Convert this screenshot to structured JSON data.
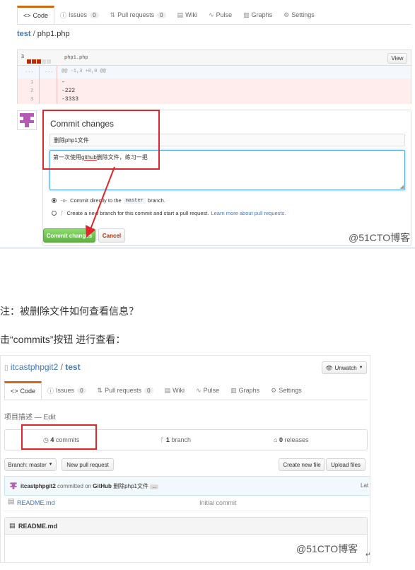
{
  "top": {
    "tabs": [
      {
        "icon": "<>",
        "label": "Code",
        "count": null
      },
      {
        "icon": "ⓘ",
        "label": "Issues",
        "count": "0"
      },
      {
        "icon": "⇅",
        "label": "Pull requests",
        "count": "0"
      },
      {
        "icon": "▤",
        "label": "Wiki",
        "count": null
      },
      {
        "icon": "∿",
        "label": "Pulse",
        "count": null
      },
      {
        "icon": "▥",
        "label": "Graphs",
        "count": null
      },
      {
        "icon": "⚙",
        "label": "Settings",
        "count": null
      }
    ],
    "breadcrumb_repo": "test",
    "breadcrumb_sep": " / ",
    "breadcrumb_file": "php1.php",
    "diff_count": "3",
    "diff_filename": "php1.php",
    "view_button": "View",
    "hunk_dots1": "...",
    "hunk_dots2": "...",
    "hunk_header": "@@ -1,3 +0,0 @@",
    "diff_lines": [
      {
        "num": "1",
        "text": "-"
      },
      {
        "num": "2",
        "text": "-222"
      },
      {
        "num": "3",
        "text": "-3333"
      }
    ],
    "commit_title": "Commit changes",
    "commit_summary": "删除php1文件",
    "commit_desc_pre": "第一次使用",
    "commit_desc_link": "github",
    "commit_desc_post": "删除文件，练习一把",
    "radio1_pre": "Commit directly to the",
    "radio1_branch": "master",
    "radio1_post": "branch.",
    "radio2_pre": "Create a new branch for this commit and start a pull request.",
    "radio2_link": "Learn more about pull requests.",
    "commit_button": "Commit changes",
    "cancel_button": "Cancel",
    "watermark": "@51CTO博客"
  },
  "text1": "注：被删除文件如何查看信息？",
  "text2": "击“commits”按钮 进行查看：",
  "bottom": {
    "owner": "itcastphpgit2",
    "sep": " / ",
    "repo": "test",
    "unwatch": "Unwatch",
    "tabs": [
      {
        "icon": "<>",
        "label": "Code",
        "count": null
      },
      {
        "icon": "ⓘ",
        "label": "Issues",
        "count": "0"
      },
      {
        "icon": "⇅",
        "label": "Pull requests",
        "count": "0"
      },
      {
        "icon": "▤",
        "label": "Wiki",
        "count": null
      },
      {
        "icon": "∿",
        "label": "Pulse",
        "count": null
      },
      {
        "icon": "▥",
        "label": "Graphs",
        "count": null
      },
      {
        "icon": "⚙",
        "label": "Settings",
        "count": null
      }
    ],
    "description": "项目描述 — Edit",
    "commits_num": "4",
    "commits_label": "commits",
    "branch_num": "1",
    "branch_label": "branch",
    "releases_num": "0",
    "releases_label": "releases",
    "branch_select": "Branch: master",
    "new_pr": "New pull request",
    "create_file": "Create new file",
    "upload_files": "Upload files",
    "last_commit_user": "itcastphpgit2",
    "last_commit_mid": "committed on",
    "last_commit_site": "GitHub",
    "last_commit_msg": "删除php1文件",
    "last_commit_more": "...",
    "last_commit_latest": "Lat",
    "file_name": "README.md",
    "file_msg": "Initial commit",
    "readme_title": "README.md",
    "watermark": "@51CTO博客"
  },
  "colors": {
    "highlight_red": "#e0262a",
    "link_blue": "#4078c0",
    "green": "#5cb85c",
    "diff_red": "#ffecec"
  }
}
